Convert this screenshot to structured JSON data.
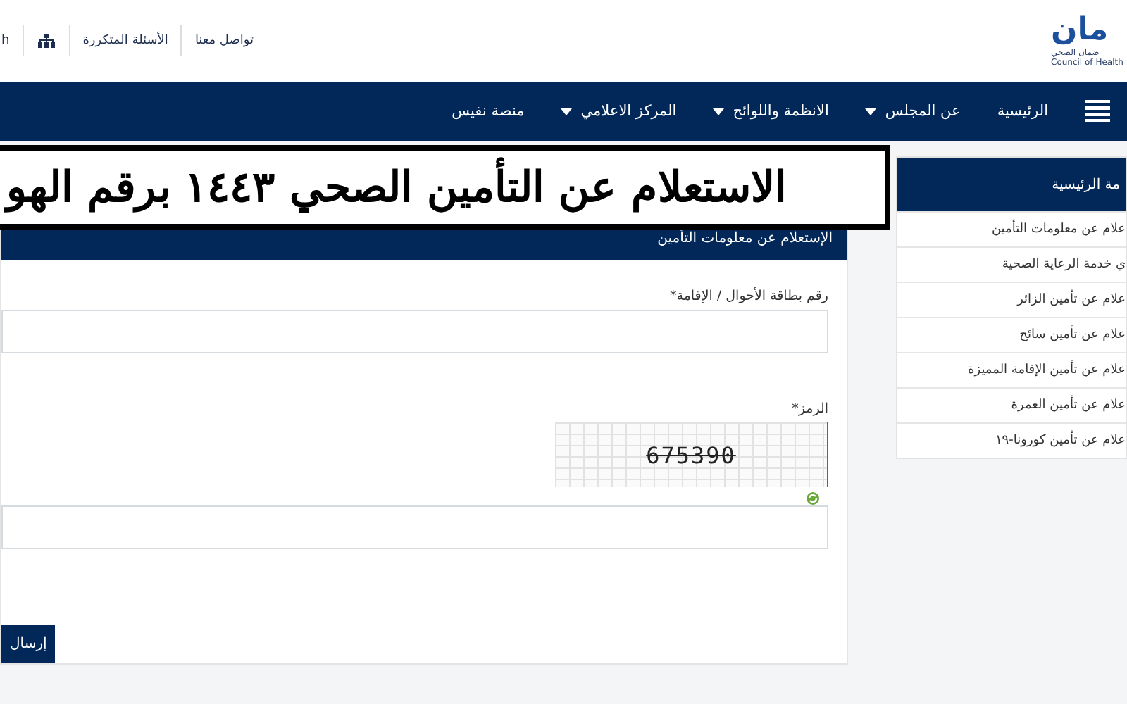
{
  "header": {
    "logo": {
      "mark": "مان",
      "name_ar": "ضمان الصحي",
      "name_en": "Council of Health"
    },
    "links": [
      {
        "label": "تواصل معنا",
        "kind": "text"
      },
      {
        "label": "الأسئلة المتكررة",
        "kind": "text"
      },
      {
        "kind": "sitemap"
      },
      {
        "label": "h",
        "kind": "text"
      }
    ]
  },
  "nav": {
    "items": [
      {
        "label": "الرئيسية",
        "dropdown": false
      },
      {
        "label": "عن المجلس",
        "dropdown": true
      },
      {
        "label": "الانظمة واللوائح",
        "dropdown": true
      },
      {
        "label": "المركز الاعلامي",
        "dropdown": true
      },
      {
        "label": "منصة نفيس",
        "dropdown": false
      }
    ]
  },
  "banner": {
    "title": "الاستعلام عن التأمين الصحي ١٤٤٣ برقم الهو"
  },
  "form": {
    "title": "الإستعلام عن معلومات التأمين",
    "id_label": "رقم بطاقة الأحوال / الإقامة*",
    "code_label": "الرمز*",
    "captcha": "675390",
    "submit": "إرسال"
  },
  "sidebar": {
    "title": "مة الرئيسية",
    "items": [
      {
        "label": "علام عن معلومات التأمين"
      },
      {
        "label": "ي خدمة الرعاية الصحية"
      },
      {
        "label": "علام عن تأمين الزائر"
      },
      {
        "label": "علام عن تأمين سائح"
      },
      {
        "label": "علام عن تأمين الإقامة المميزة"
      },
      {
        "label": "علام عن تأمين العمرة"
      },
      {
        "label": "علام عن تأمين كورونا-١٩"
      }
    ]
  }
}
